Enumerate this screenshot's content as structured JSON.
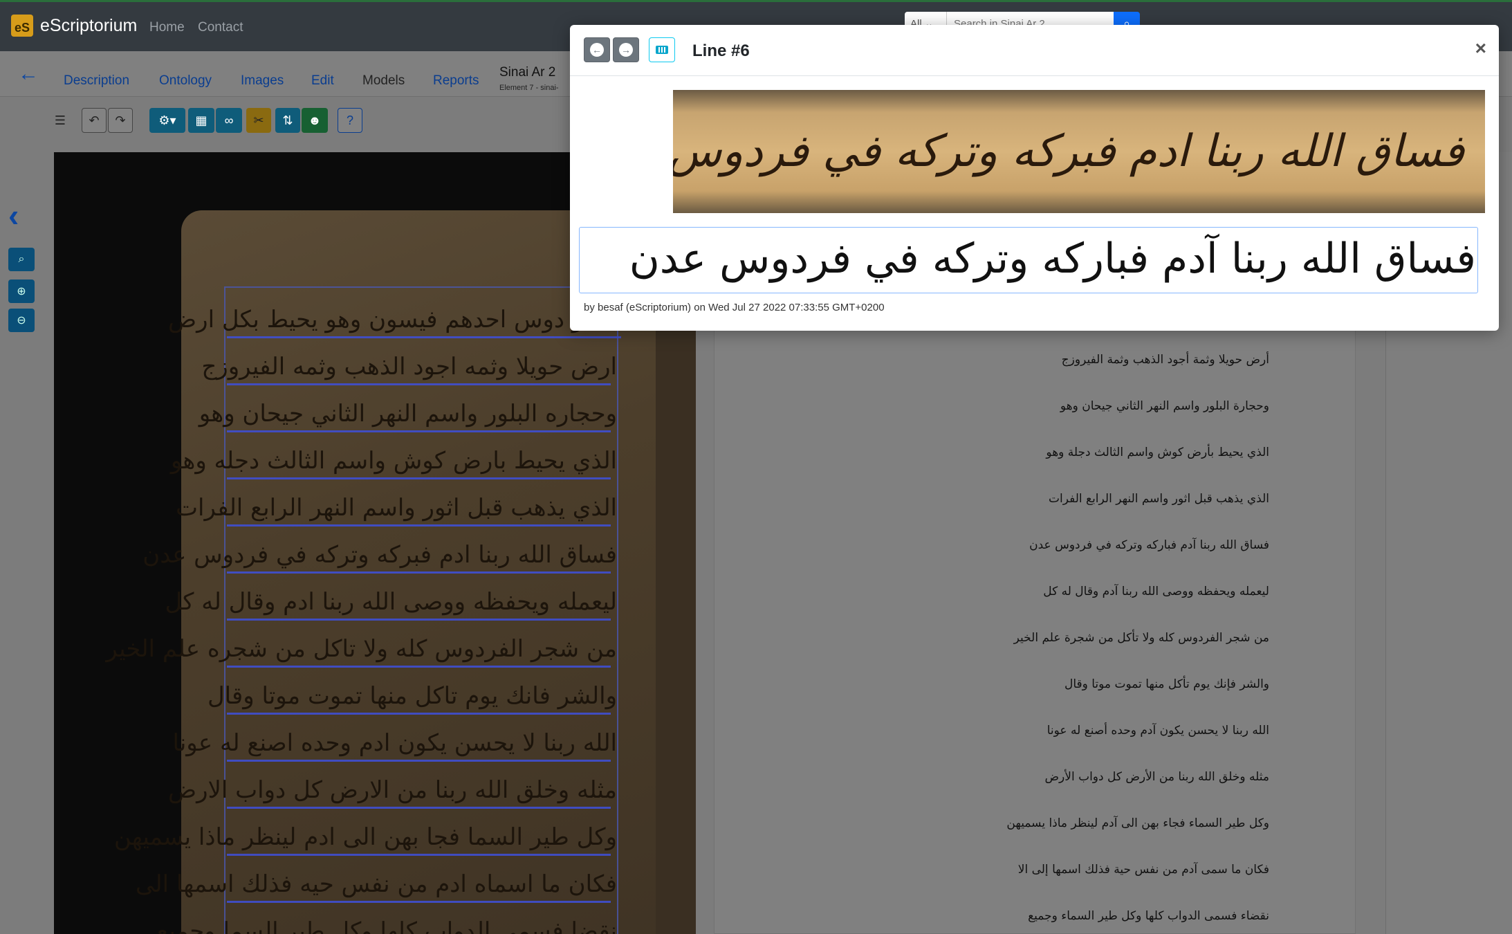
{
  "navbar": {
    "brand_logo": "eS",
    "brand_name": "eScriptorium",
    "links": [
      "Home",
      "Contact"
    ],
    "search_scope": "All",
    "search_placeholder": "Search in Sinai Ar 2"
  },
  "tabs": [
    "Description",
    "Ontology",
    "Images",
    "Edit",
    "Models",
    "Reports"
  ],
  "active_tab": "Edit",
  "document": {
    "title": "Sinai Ar 2",
    "subtitle": "Element 7 - sinai-"
  },
  "manuscript_lines": [
    "يدعو دوس احدهم فيسون وهو يحيط بكل ارض",
    "ارض حويلا وثمه اجود الذهب وثمه الفيروزج",
    "وحجاره البلور واسم النهر الثاني جيحان وهو",
    "الذي يحيط بارض كوش واسم الثالث دجله وهو",
    "الذي يذهب قبل اثور واسم النهر الرابع الفرات",
    "فساق الله ربنا ادم فبركه وتركه في فردوس عدن",
    "ليعمله ويحفظه ووصى الله ربنا ادم وقال له كل",
    "من شجر الفردوس كله ولا تاكل من شجره علم الخير",
    "والشر فانك يوم تاكل منها تموت موتا وقال",
    "الله ربنا لا يحسن يكون ادم وحده اصنع له عونا",
    "مثله وخلق الله ربنا من الارض كل دواب الارض",
    "وكل طير السما فجا بهن الى ادم لينظر ماذا يسميهن",
    "فكان ما اسماه ادم من نفس حيه فذلك اسمها الى",
    "نقضا فسمى الدواب كلها وكل طير السما وجميع"
  ],
  "transcription_lines": [
    "أرض حويلا وثمة أجود الذهب وثمة الفيروزج",
    "وحجارة البلور واسم النهر الثاني جيحان وهو",
    "الذي يحيط بأرض كوش واسم الثالث دجلة وهو",
    "الذي يذهب قبل اثور واسم النهر الرابع الفرات",
    "فساق الله ربنا آدم فباركه وتركه في فردوس عدن",
    "ليعمله ويحفظه ووصى الله ربنا آدم وقال له كل",
    "من شجر الفردوس كله ولا تأكل من شجرة علم الخير",
    "والشر فإنك يوم تأكل منها تموت موتا وقال",
    "الله ربنا لا يحسن يكون آدم وحده أصنع له عونا",
    "مثله وخلق الله ربنا من الأرض كل دواب الأرض",
    "وكل طير السماء فجاء بهن الى آدم لينظر ماذا يسميهن",
    "فكان ما سمى آدم من نفس حية فذلك اسمها إلى الا",
    "نقضاء فسمى الدواب كلها وكل طير السماء وجميع"
  ],
  "modal": {
    "title": "Line #6",
    "close": "×",
    "line_image_text": "فساق الله ربنا ادم فبركه وتركه في فردوس عدن",
    "line_transcription": "فساق الله ربنا آدم فباركه وتركه في فردوس عدن",
    "meta": "by besaf (eScriptorium) on Wed Jul 27 2022 07:33:55 GMT+0200"
  },
  "colors": {
    "primary": "#0d6efd",
    "navbar": "#343a40",
    "toolbar_teal": "#1a7fa8",
    "toolbar_warning": "#d4a017",
    "toolbar_success": "#1e8a4a"
  }
}
